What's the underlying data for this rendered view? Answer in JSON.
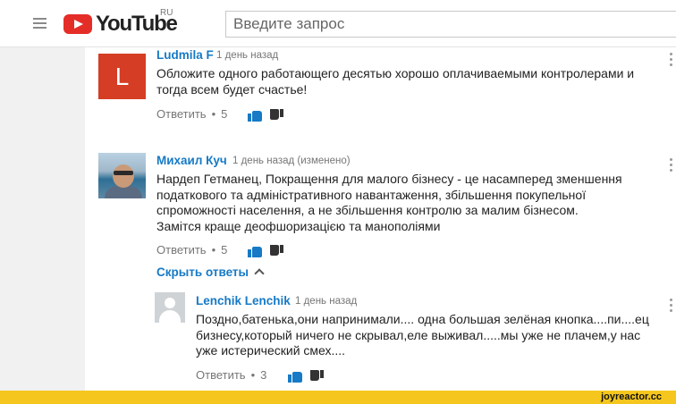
{
  "header": {
    "logo_text": "YouTube",
    "logo_locale": "RU",
    "search_placeholder": "Введите запрос"
  },
  "comments": [
    {
      "avatar_letter": "L",
      "avatar_color": "#d53d24",
      "author": "Ludmila F",
      "time": "1 день назад",
      "lines": [
        "Обложите одного работающего десятью хорошо оплачиваемыми контролерами и",
        "тогда всем будет счастье!"
      ],
      "reply_label": "Ответить",
      "likes": "5"
    },
    {
      "author": "Михаил Куч",
      "time": "1 день назад (изменено)",
      "lines": [
        "Нардеп Гетманец, Покращення для малого бізнесу - це насамперед зменшення",
        "податкового та адміністративного навантаження, збільшення покупельної",
        "спроможності населення, а не збільшення контролю за малим бізнесом.",
        "Замітся краще деофшоризацією та манополіями"
      ],
      "reply_label": "Ответить",
      "likes": "5",
      "hide_replies_label": "Скрыть ответы"
    }
  ],
  "replies": [
    {
      "author": "Lenchik Lenchik",
      "time": "1 день назад",
      "lines": [
        "Поздно,батенька,они напринимали.... одна большая зелёная кнопка....пи....ец",
        "бизнесу,который ничего не скрывал,еле выживал.....мы уже не плачем,у нас",
        "уже истерический смех...."
      ],
      "reply_label": "Ответить",
      "likes": "3"
    }
  ],
  "footer": {
    "brand": "joyreactor.cc",
    "color": "#f5c61e"
  },
  "colors": {
    "link": "#167ac6",
    "youtube_red": "#e52d27"
  }
}
